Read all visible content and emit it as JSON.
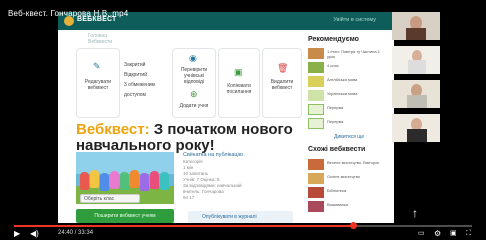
{
  "window": {
    "title": "Веб-квест. Гончарова Н.В..mp4"
  },
  "site": {
    "name": "ВЕБКВЕСТ",
    "header_hint": "Увійти в систему",
    "breadcrumb": [
      "Головна",
      "Вебквести"
    ]
  },
  "tiles": [
    {
      "label": "Редагувати вебквест",
      "icon": "pencil-icon"
    },
    {
      "label": "Закритий ▾",
      "icon": "lock-icon"
    },
    {
      "label": "Перевірити учнівські відповіді",
      "icon": "eye-icon"
    },
    {
      "label": "Копіювати посилання",
      "icon": "copy-icon"
    },
    {
      "label": "Видалити вебквест",
      "icon": "trash-icon"
    }
  ],
  "tile_extra": {
    "private_links": [
      "Закритий",
      "Відкритий",
      "3 обмеженим доступом"
    ],
    "add_student": "Додати учня"
  },
  "heading": {
    "accent": "Вебквест:",
    "rest": " З початком нового",
    "line2": "навчального року!"
  },
  "meta": {
    "title": "Свёкатка на публікацію",
    "lines": [
      "Категорія",
      "1 мін",
      "10 запитань",
      "Учнів: 7 Оцінка: 5",
      "За відповідями: навчальний",
      "вчитель: Гончарова",
      "94  17"
    ]
  },
  "select": {
    "placeholder": "Оберіть клас"
  },
  "buttons": {
    "start": "Поширити вебквест учням",
    "journal": "Опублікувати в журналі"
  },
  "sidebar": {
    "recommended": "Рекомендуємо",
    "similar": "Схожі вебквести",
    "more_link": "Дивитися ще",
    "rec_items": [
      "1 етап: Повітря ту Частина 1 урок",
      "4 клас",
      "Англійська мова",
      "Українська мова",
      "Перерва",
      "Перерва"
    ],
    "similar_items": [
      "Веселе мистецтво. Вівторок",
      "Осіннє мистецтво",
      "Бібліотека",
      "Вишиванка"
    ]
  },
  "player": {
    "time": "24:40 / 33:34",
    "progress": 0.74
  },
  "colors": {
    "accent": "#f1a30d",
    "brand": "#0f5d5a",
    "progress": "#e32"
  }
}
